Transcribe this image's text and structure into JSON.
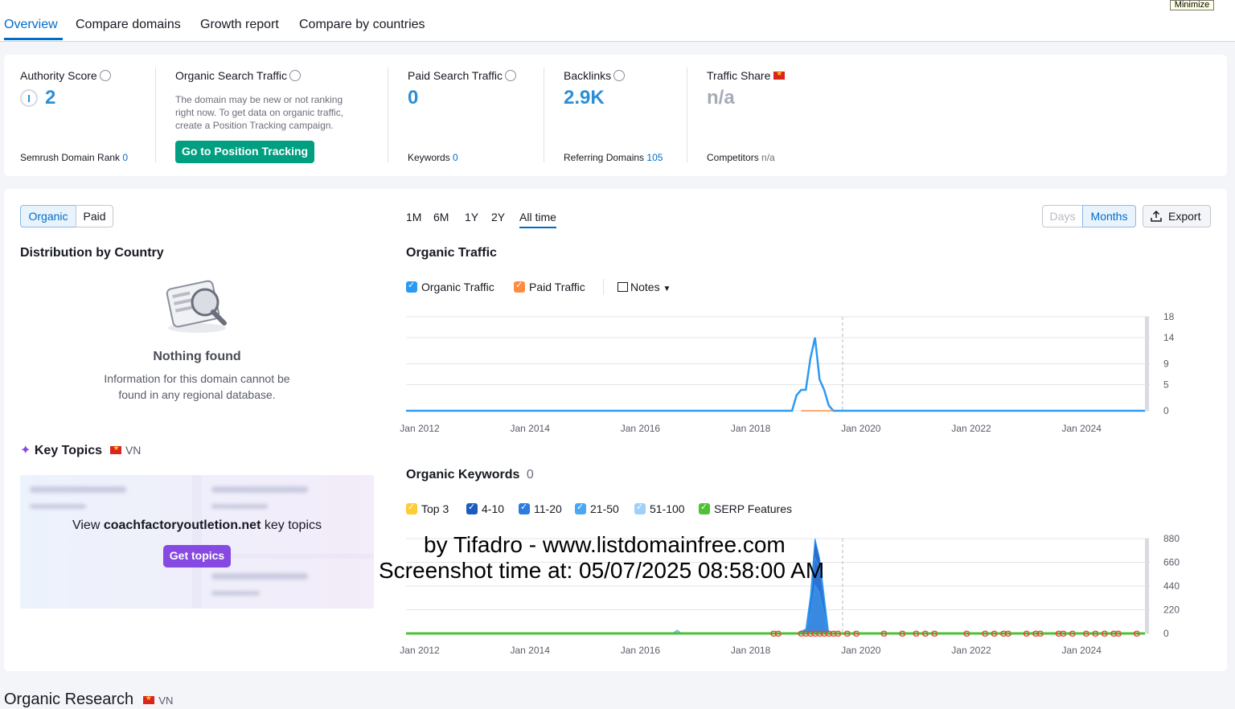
{
  "window": {
    "minimize_label": "Minimize"
  },
  "tabs": [
    {
      "label": "Overview",
      "active": true
    },
    {
      "label": "Compare domains"
    },
    {
      "label": "Growth report"
    },
    {
      "label": "Compare by countries"
    }
  ],
  "metrics": {
    "authority": {
      "label": "Authority Score",
      "value": "2",
      "sub_label": "Semrush Domain Rank",
      "sub_value": "0"
    },
    "organic": {
      "label": "Organic Search Traffic",
      "note": [
        "The domain may be new or not ranking",
        "right now. To get data on organic traffic,",
        "create a Position Tracking campaign."
      ],
      "button": "Go to Position Tracking"
    },
    "paid": {
      "label": "Paid Search Traffic",
      "value": "0",
      "sub_label": "Keywords",
      "sub_value": "0"
    },
    "backlinks": {
      "label": "Backlinks",
      "value": "2.9K",
      "sub_label": "Referring Domains",
      "sub_value": "105"
    },
    "share": {
      "label": "Traffic Share",
      "value": "n/a",
      "sub_label": "Competitors",
      "sub_value": "n/a"
    }
  },
  "toggles": {
    "organic": "Organic",
    "paid": "Paid"
  },
  "periods": [
    "1M",
    "6M",
    "1Y",
    "2Y",
    "All time"
  ],
  "active_period": "All time",
  "granularity": {
    "days": "Days",
    "months": "Months"
  },
  "export_label": "Export",
  "distribution": {
    "title": "Distribution by Country",
    "empty_title": "Nothing found",
    "empty_text": [
      "Information for this domain cannot be",
      "found in any regional database."
    ]
  },
  "key_topics": {
    "title": "Key Topics",
    "country": "VN",
    "view_prefix": "View",
    "domain": "coachfactoryoutletion.net",
    "view_suffix": "key topics",
    "button": "Get topics"
  },
  "traffic_chart_title": "Organic Traffic",
  "legend": {
    "organic": "Organic Traffic",
    "paid": "Paid Traffic",
    "notes": "Notes"
  },
  "keywords_section": {
    "title": "Organic Keywords",
    "count": "0",
    "filters": [
      "Top 3",
      "4-10",
      "11-20",
      "21-50",
      "51-100",
      "SERP Features"
    ]
  },
  "colors": {
    "organic": "#2b9af3",
    "paid": "#ff8c43",
    "top3": "#ffcc33",
    "k4_10": "#1a5bbf",
    "k11_20": "#2b7be0",
    "k21_50": "#49a7f5",
    "k51_100": "#9ed0fa",
    "serp": "#4ec135"
  },
  "watermark": [
    "by Tifadro - www.listdomainfree.com",
    "Screenshot time at: 05/07/2025 08:58:00 AM"
  ],
  "organic_research": {
    "title": "Organic Research",
    "country": "VN"
  },
  "chart_data": [
    {
      "type": "line",
      "title": "Organic Traffic",
      "x_ticks": [
        "Jan 2012",
        "Jan 2014",
        "Jan 2016",
        "Jan 2018",
        "Jan 2020",
        "Jan 2022",
        "Jan 2024"
      ],
      "y_ticks": [
        0,
        5,
        9,
        14,
        18
      ],
      "ylim": [
        0,
        18
      ],
      "series": [
        {
          "name": "Organic Traffic",
          "x": [
            "2018-10",
            "2018-11",
            "2018-12",
            "2019-01",
            "2019-02",
            "2019-03",
            "2019-04",
            "2019-05",
            "2019-06",
            "2019-07"
          ],
          "values": [
            0,
            3,
            4,
            4,
            10,
            14,
            6,
            4,
            1,
            0
          ]
        },
        {
          "name": "Paid Traffic",
          "values": [
            0
          ]
        }
      ]
    },
    {
      "type": "area",
      "title": "Organic Keywords",
      "x_ticks": [
        "Jan 2012",
        "Jan 2014",
        "Jan 2016",
        "Jan 2018",
        "Jan 2020",
        "Jan 2022",
        "Jan 2024"
      ],
      "y_ticks": [
        0,
        220,
        440,
        660,
        880
      ],
      "ylim": [
        0,
        880
      ],
      "series": [
        {
          "name": "Top 3",
          "values": [
            0
          ]
        },
        {
          "name": "4-10",
          "x": [
            "2018-11",
            "2019-01",
            "2019-02",
            "2019-03",
            "2019-04",
            "2019-06"
          ],
          "values": [
            0,
            40,
            350,
            880,
            700,
            0
          ]
        },
        {
          "name": "11-20",
          "x": [
            "2018-11",
            "2019-01",
            "2019-02",
            "2019-03",
            "2019-04",
            "2019-06"
          ],
          "values": [
            0,
            30,
            300,
            700,
            600,
            0
          ]
        },
        {
          "name": "21-50",
          "x": [
            "2018-11",
            "2019-01",
            "2019-02",
            "2019-03",
            "2019-04",
            "2019-06"
          ],
          "values": [
            0,
            20,
            200,
            450,
            380,
            0
          ]
        },
        {
          "name": "51-100",
          "x": [
            "2016-08",
            "2016-09",
            "2016-10"
          ],
          "values": [
            0,
            30,
            0
          ]
        }
      ]
    }
  ]
}
